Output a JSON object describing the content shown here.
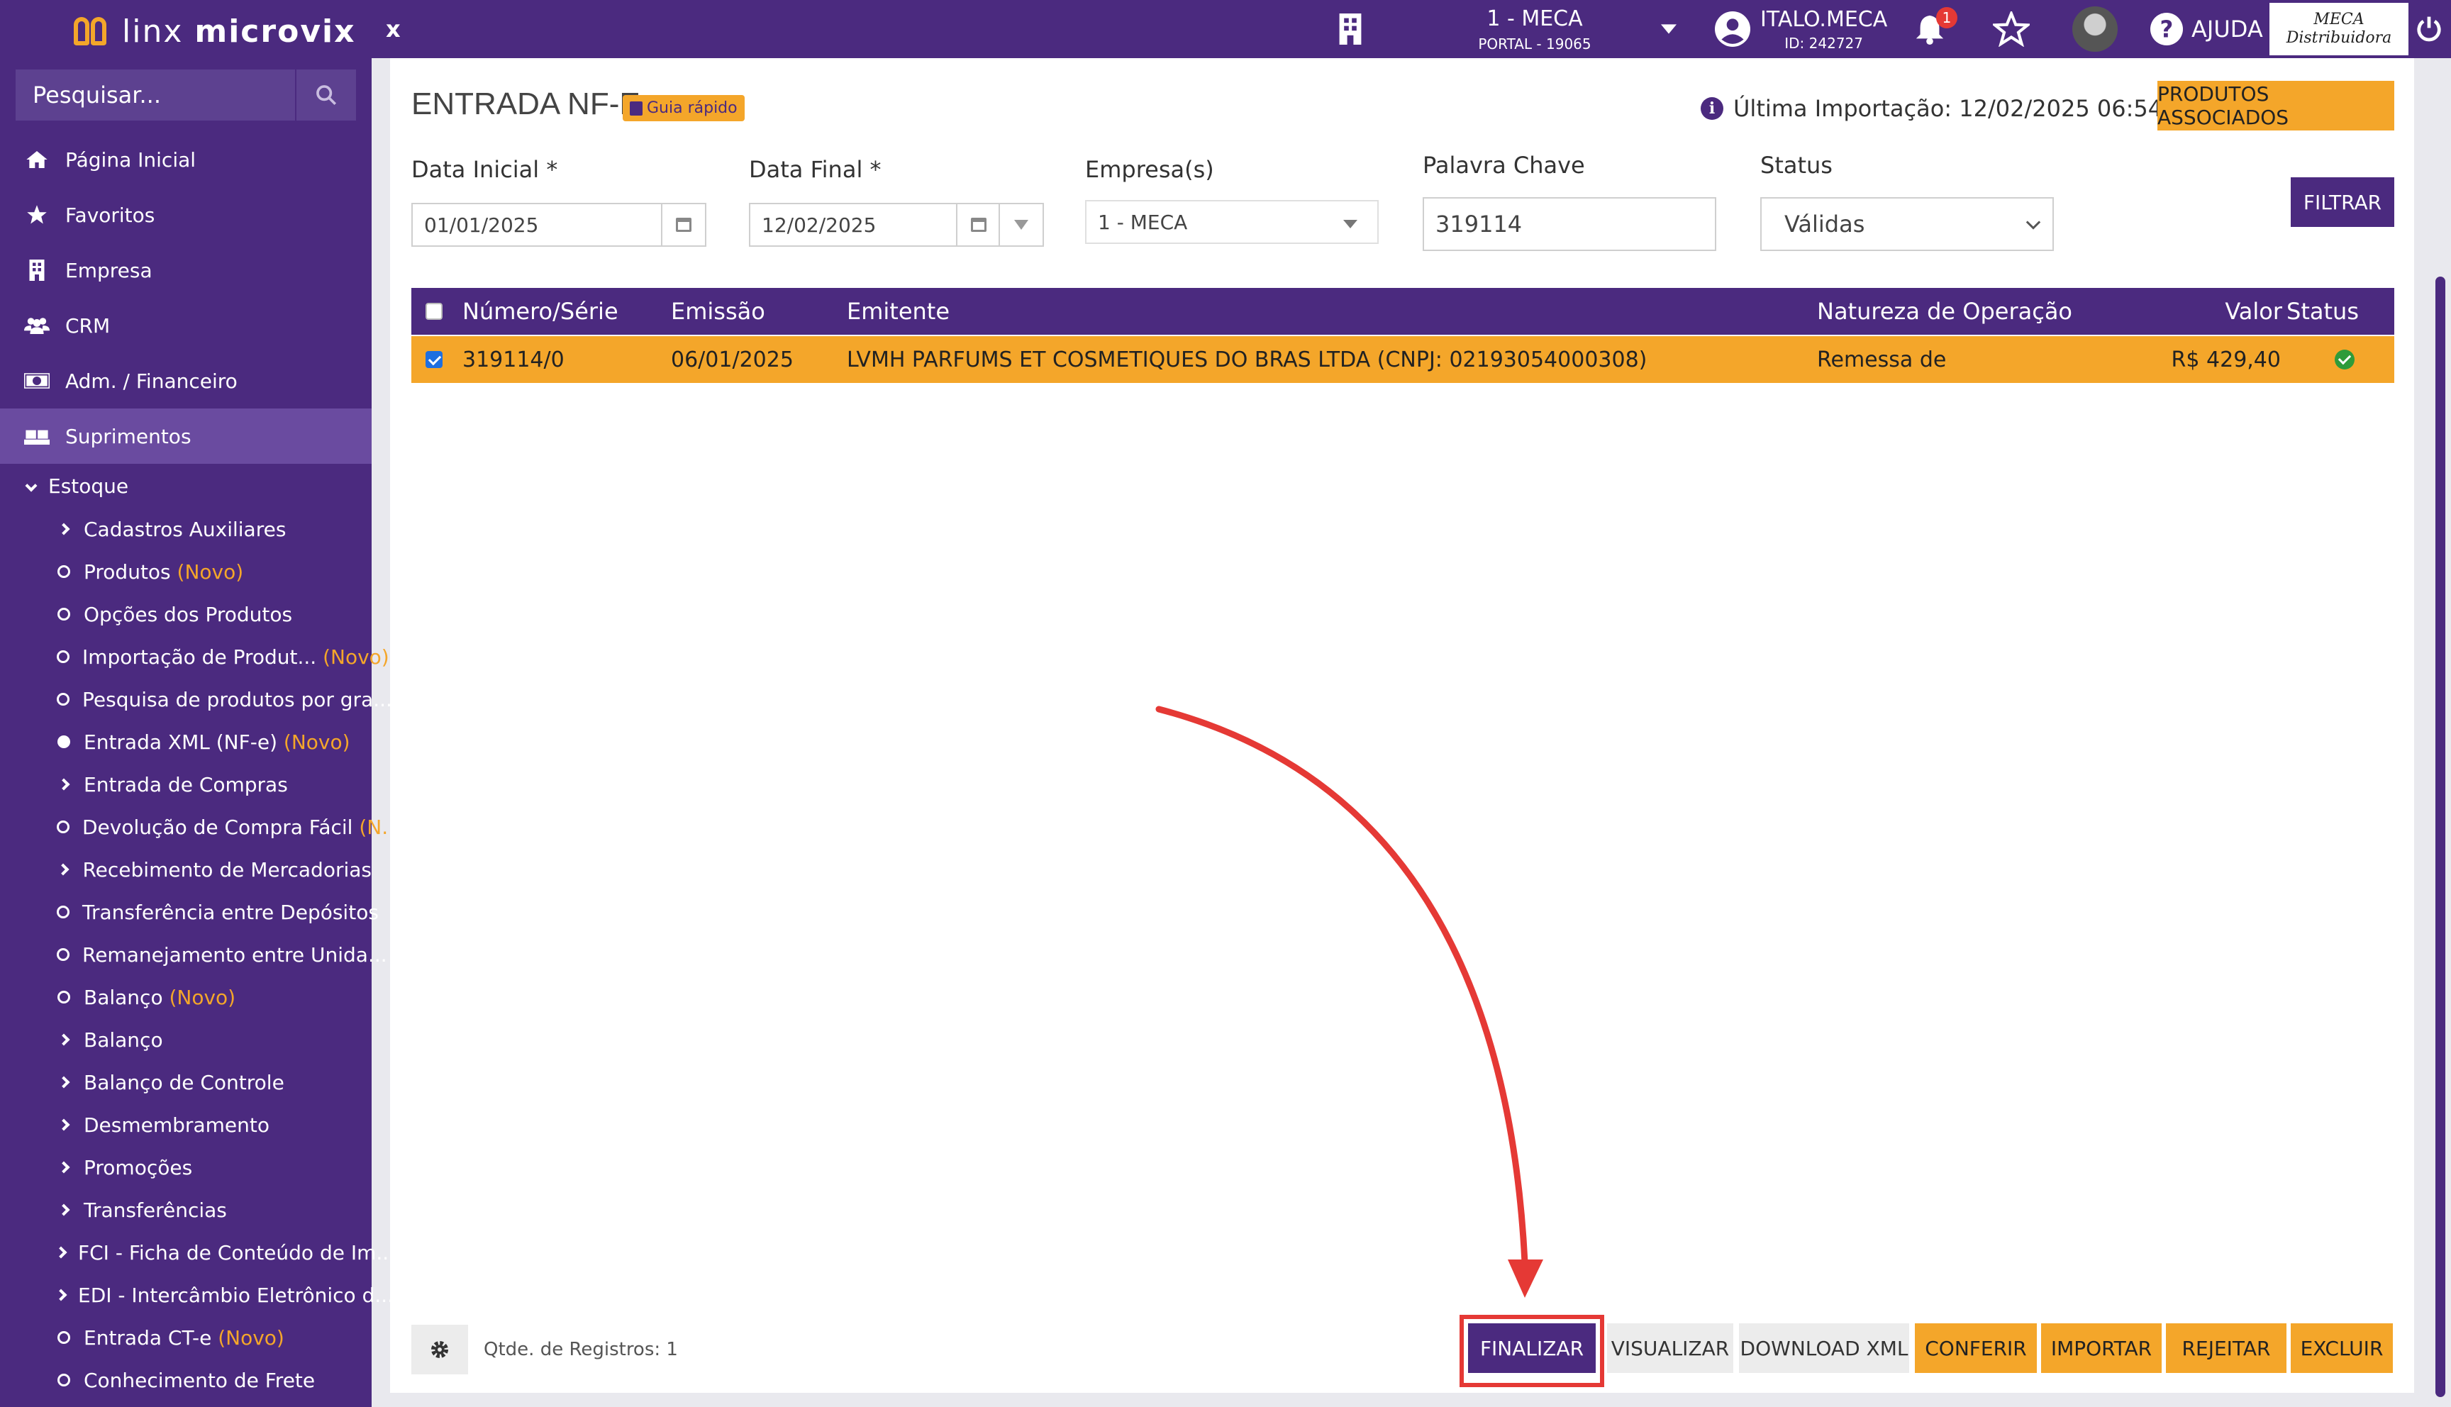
{
  "brand": {
    "name_light": "linx ",
    "name_bold": "microvix"
  },
  "search": {
    "placeholder": "Pesquisar..."
  },
  "sidebar": {
    "main": [
      {
        "label": "Página Inicial",
        "icon": "home-icon"
      },
      {
        "label": "Favoritos",
        "icon": "star-icon"
      },
      {
        "label": "Empresa",
        "icon": "building-icon"
      },
      {
        "label": "CRM",
        "icon": "users-icon"
      },
      {
        "label": "Adm. / Financeiro",
        "icon": "money-icon"
      },
      {
        "label": "Suprimentos",
        "icon": "boxes-icon"
      }
    ],
    "estoque": {
      "label": "Estoque"
    },
    "items": [
      {
        "label": "Cadastros Auxiliares",
        "novo": "",
        "bullet": "chevron"
      },
      {
        "label": "Produtos ",
        "novo": "(Novo)",
        "bullet": "circle"
      },
      {
        "label": "Opções dos Produtos",
        "novo": "",
        "bullet": "circle"
      },
      {
        "label": "Importação de Produt...",
        "novo": " (Novo)",
        "bullet": "circle"
      },
      {
        "label": "Pesquisa de produtos por gra...",
        "novo": "",
        "bullet": "circle"
      },
      {
        "label": "Entrada XML (NF-e) ",
        "novo": "(Novo)",
        "bullet": "dot"
      },
      {
        "label": "Entrada de Compras",
        "novo": "",
        "bullet": "chevron"
      },
      {
        "label": "Devolução de Compra Fácil ",
        "novo": "(N...",
        "bullet": "circle"
      },
      {
        "label": "Recebimento de Mercadorias",
        "novo": "",
        "bullet": "chevron"
      },
      {
        "label": "Transferência entre Depósitos",
        "novo": "",
        "bullet": "circle"
      },
      {
        "label": "Remanejamento entre Unida...",
        "novo": "",
        "bullet": "circle"
      },
      {
        "label": "Balanço ",
        "novo": "(Novo)",
        "bullet": "circle"
      },
      {
        "label": "Balanço",
        "novo": "",
        "bullet": "chevron"
      },
      {
        "label": "Balanço de Controle",
        "novo": "",
        "bullet": "chevron"
      },
      {
        "label": "Desmembramento",
        "novo": "",
        "bullet": "chevron"
      },
      {
        "label": "Promoções",
        "novo": "",
        "bullet": "chevron"
      },
      {
        "label": "Transferências",
        "novo": "",
        "bullet": "chevron"
      },
      {
        "label": "FCI - Ficha de Conteúdo de Im...",
        "novo": "",
        "bullet": "chevron"
      },
      {
        "label": "EDI - Intercâmbio Eletrônico d...",
        "novo": "",
        "bullet": "chevron"
      },
      {
        "label": "Entrada CT-e ",
        "novo": "(Novo)",
        "bullet": "circle"
      },
      {
        "label": "Conhecimento de Frete",
        "novo": "",
        "bullet": "circle"
      }
    ]
  },
  "topbar": {
    "close": "x",
    "empresa": "1 - MECA",
    "portal": "PORTAL - 19065",
    "user": "ITALO.MECA",
    "user_id": "ID: 242727",
    "notifications": "1",
    "help": "AJUDA",
    "brand_line1": "MECA",
    "brand_line2": "Distribuidora"
  },
  "page": {
    "title": "ENTRADA NF-E",
    "guia": "Guia rápido",
    "last_import": "Última Importação: 12/02/2025 06:54",
    "btn_assoc": "PRODUTOS ASSOCIADOS",
    "btn_filtrar": "FILTRAR"
  },
  "filters": {
    "data_inicial_label": "Data Inicial *",
    "data_inicial": "01/01/2025",
    "data_final_label": "Data Final *",
    "data_final": "12/02/2025",
    "empresa_label": "Empresa(s)",
    "empresa": "1 - MECA",
    "palavra_label": "Palavra Chave",
    "palavra": "319114",
    "status_label": "Status",
    "status": "Válidas"
  },
  "table": {
    "headers": [
      "Número/Série",
      "Emissão",
      "Emitente",
      "Natureza de Operação",
      "Valor",
      "Status"
    ],
    "rows": [
      {
        "numero": "319114/0",
        "emissao": "06/01/2025",
        "emitente": "LVMH PARFUMS ET COSMETIQUES DO BRAS LTDA (CNPJ: 02193054000308)",
        "natureza": "Remessa de",
        "valor": "R$ 429,40",
        "checked": true
      }
    ]
  },
  "footer": {
    "qtd": "Qtde. de Registros: 1",
    "finalizar": "FINALIZAR",
    "visualizar": "VISUALIZAR",
    "download": "DOWNLOAD XML",
    "conferir": "CONFERIR",
    "importar": "IMPORTAR",
    "rejeitar": "REJEITAR",
    "excluir": "EXCLUIR"
  },
  "colors": {
    "primary": "#4b2a7f",
    "accent": "#f4a62a",
    "annotation": "#e53935",
    "success": "#2e9b3a"
  }
}
